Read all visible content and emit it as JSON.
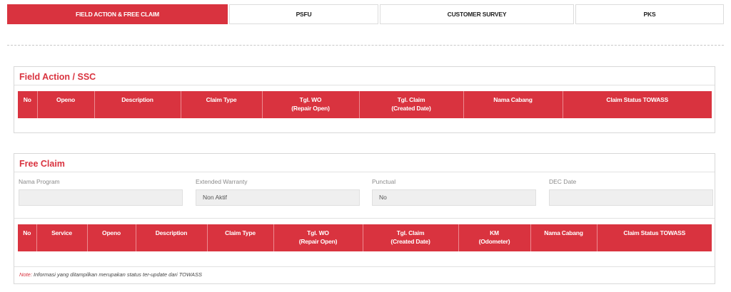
{
  "tabs": [
    {
      "label": "FIELD ACTION & FREE CLAIM",
      "active": true
    },
    {
      "label": "PSFU",
      "active": false
    },
    {
      "label": "CUSTOMER SURVEY",
      "active": false
    },
    {
      "label": "PKS",
      "active": false
    }
  ],
  "field_action": {
    "title": "Field Action / SSC",
    "columns": [
      {
        "label": "No"
      },
      {
        "label": "Openo"
      },
      {
        "label": "Description"
      },
      {
        "label": "Claim Type"
      },
      {
        "label": "Tgl. WO",
        "sub": "(Repair Open)"
      },
      {
        "label": "Tgl. Claim",
        "sub": "(Created Date)"
      },
      {
        "label": "Nama Cabang"
      },
      {
        "label": "Claim Status TOWASS"
      }
    ]
  },
  "free_claim": {
    "title": "Free Claim",
    "fields": [
      {
        "label": "Nama Program",
        "value": ""
      },
      {
        "label": "Extended Warranty",
        "value": "Non Aktif"
      },
      {
        "label": "Punctual",
        "value": "No"
      },
      {
        "label": "DEC Date",
        "value": ""
      }
    ],
    "columns": [
      {
        "label": "No"
      },
      {
        "label": "Service"
      },
      {
        "label": "Openo"
      },
      {
        "label": "Description"
      },
      {
        "label": "Claim Type"
      },
      {
        "label": "Tgl. WO",
        "sub": "(Repair Open)"
      },
      {
        "label": "Tgl. Claim",
        "sub": "(Created Date)"
      },
      {
        "label": "KM",
        "sub": "(Odometer)"
      },
      {
        "label": "Nama Cabang"
      },
      {
        "label": "Claim Status TOWASS"
      }
    ],
    "note_key": "Note:",
    "note_text": " Informasi yang ditampilkan merupakan status ter-update dari TOWASS"
  },
  "colors": {
    "accent": "#d9333f",
    "field_bg": "#efefef"
  }
}
